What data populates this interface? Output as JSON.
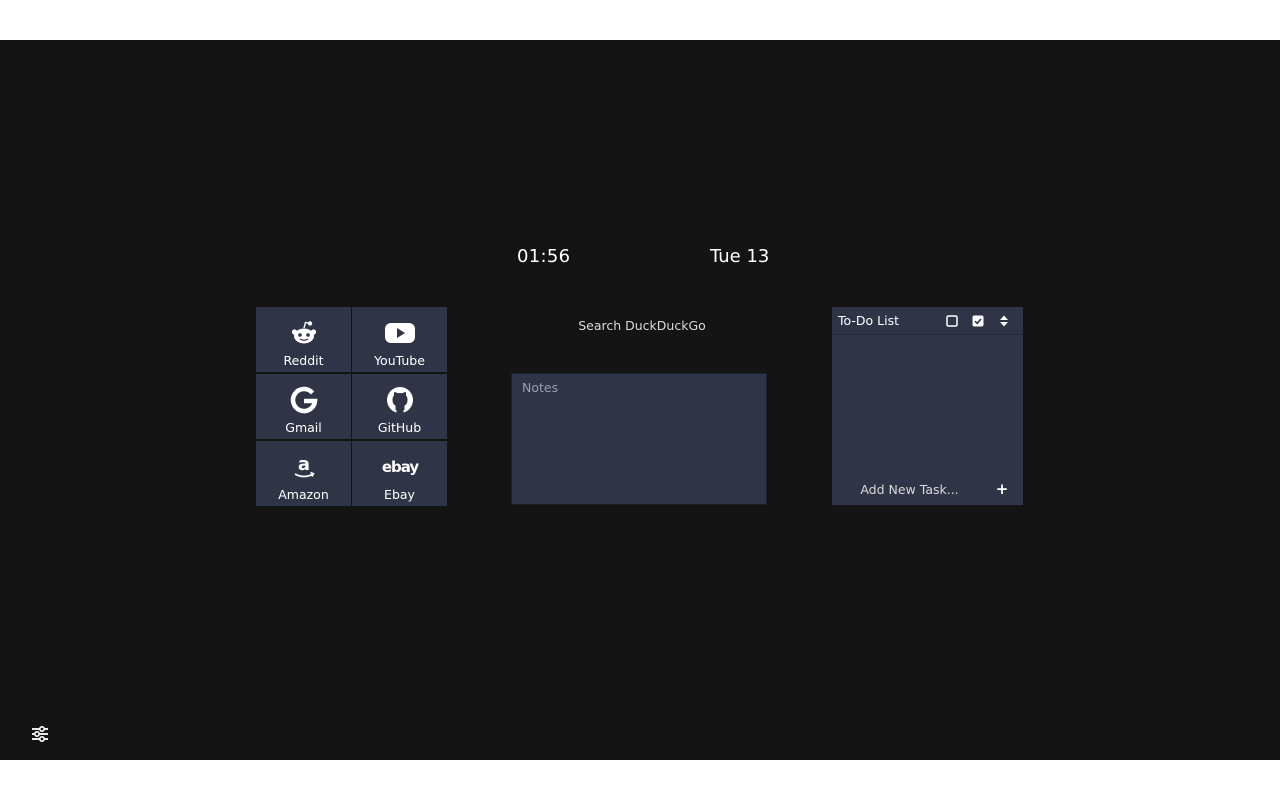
{
  "clock": {
    "time": "01:56",
    "date": "Tue 13"
  },
  "shortcuts": [
    {
      "label": "Reddit",
      "icon": "reddit-icon"
    },
    {
      "label": "YouTube",
      "icon": "youtube-icon"
    },
    {
      "label": "Gmail",
      "icon": "google-icon"
    },
    {
      "label": "GitHub",
      "icon": "github-icon"
    },
    {
      "label": "Amazon",
      "icon": "amazon-icon"
    },
    {
      "label": "Ebay",
      "icon": "ebay-icon",
      "icon_text": "ebay"
    }
  ],
  "search": {
    "placeholder": "Search DuckDuckGo",
    "value": ""
  },
  "notes": {
    "placeholder": "Notes",
    "value": ""
  },
  "todo": {
    "title": "To-Do List",
    "tasks": [],
    "add_placeholder": "Add New Task...",
    "add_label": "+"
  },
  "colors": {
    "background": "#141414",
    "tile": "#2f3446",
    "text": "#ffffff"
  }
}
